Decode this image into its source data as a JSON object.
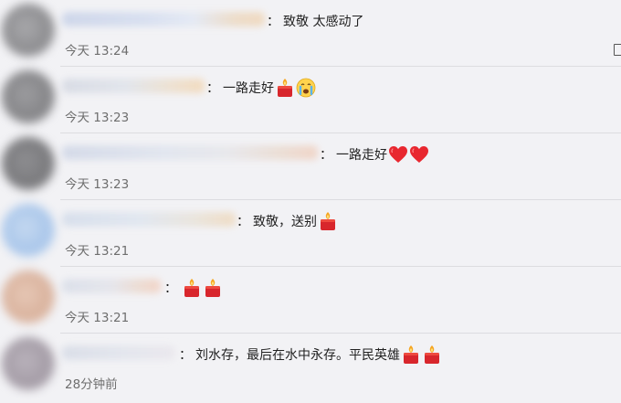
{
  "comments": [
    {
      "text": "致敬  太感动了",
      "time": "今天 13:24",
      "emojis": []
    },
    {
      "text": "一路走好",
      "time": "今天 13:23",
      "emojis": [
        "candle",
        "crying-face"
      ]
    },
    {
      "text": "一路走好",
      "time": "今天 13:23",
      "emojis": [
        "heart",
        "heart"
      ]
    },
    {
      "text": "致敬，送别",
      "time": "今天 13:21",
      "emojis": [
        "candle"
      ]
    },
    {
      "text": "",
      "time": "今天 13:21",
      "emojis": [
        "candle",
        "candle"
      ]
    },
    {
      "text": "刘水存，最后在水中永存。平民英雄",
      "time": "28分钟前",
      "emojis": [
        "candle",
        "candle"
      ]
    }
  ],
  "separator": "："
}
